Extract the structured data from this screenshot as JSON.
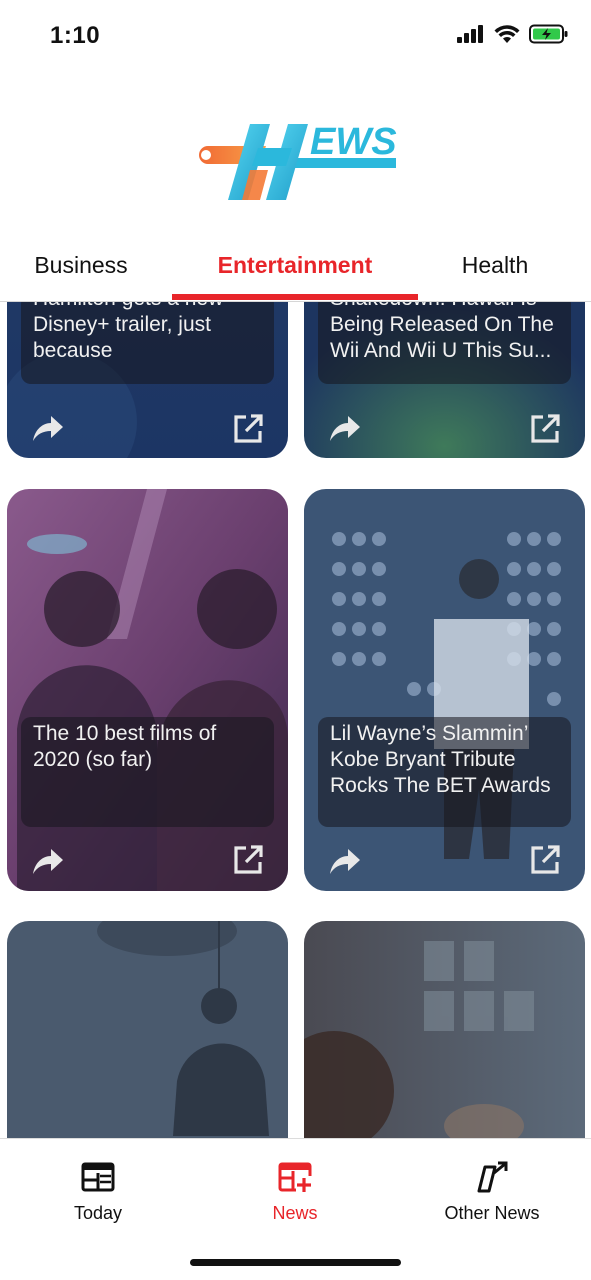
{
  "status_bar": {
    "time": "1:10",
    "icons": [
      "cellular-signal-icon",
      "wifi-icon",
      "battery-charging-icon"
    ],
    "battery_color": "#31c94a"
  },
  "logo": {
    "text": "EWS",
    "colors": {
      "cyan": "#2bb8dc",
      "orange": "#f47a36"
    }
  },
  "tabs": [
    {
      "label": "Business",
      "active": false
    },
    {
      "label": "Entertainment",
      "active": true
    },
    {
      "label": "Health",
      "active": false
    }
  ],
  "accent_color": "#e8252a",
  "articles": [
    {
      "caption": "Hamilton gets a new Disney+ trailer, just because",
      "icons": [
        "share-icon",
        "open-external-icon"
      ]
    },
    {
      "caption": "Shakedown: Hawaii Is Being Released On The Wii And Wii U This Su...",
      "icons": [
        "share-icon",
        "open-external-icon"
      ]
    },
    {
      "caption": "The 10 best films of 2020 (so far)",
      "icons": [
        "share-icon",
        "open-external-icon"
      ]
    },
    {
      "caption": "Lil Wayne’s Slammin’ Kobe Bryant Tribute Rocks The BET Awards",
      "icons": [
        "share-icon",
        "open-external-icon"
      ]
    },
    {
      "caption": "",
      "icons": []
    },
    {
      "caption": "",
      "icons": []
    }
  ],
  "bottom_nav": [
    {
      "label": "Today",
      "icon": "newspaper-icon",
      "active": false
    },
    {
      "label": "News",
      "icon": "add-news-icon",
      "active": true
    },
    {
      "label": "Other News",
      "icon": "external-news-icon",
      "active": false
    }
  ]
}
